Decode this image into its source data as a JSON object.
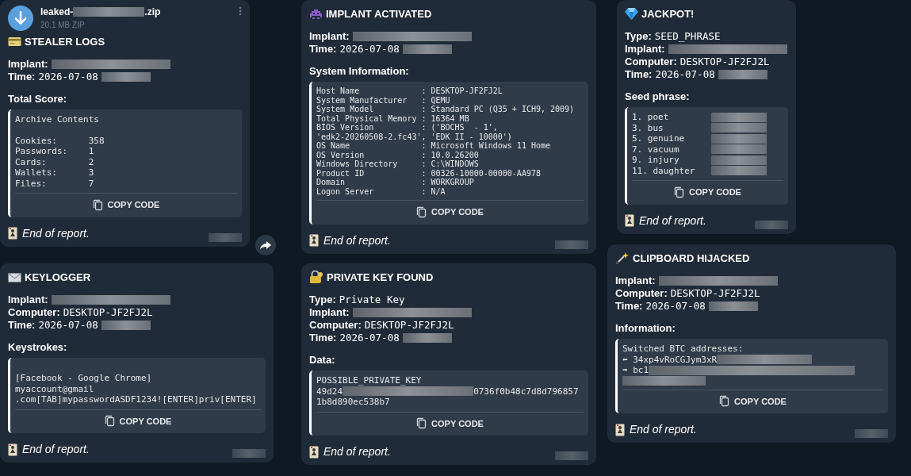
{
  "cards": [
    {
      "file": {
        "name_start": "leaked-",
        "name_redacted": true,
        "name_end": ".zip",
        "size": "20.1 MB ZIP"
      },
      "kind": "card",
      "title": "STEALER LOGS",
      "fields": [
        {
          "label": "Implant:",
          "redacted": true
        },
        {
          "label": "Time:",
          "value": "2026-07-08",
          "redacted": true
        }
      ],
      "section": "Total Score:",
      "code": [
        {
          "kind": "text",
          "text": "Archive Contents"
        },
        {
          "kind": "blank"
        },
        {
          "kind": "text",
          "text": "Cookies:      358"
        },
        {
          "kind": "text",
          "text": "Passwords:    1"
        },
        {
          "kind": "text",
          "text": "Cards:        2"
        },
        {
          "kind": "text",
          "text": "Wallets:      3"
        },
        {
          "kind": "text",
          "text": "Files:        7"
        }
      ],
      "copy": "COPY CODE",
      "footer": "End of report.",
      "forward_button": true
    },
    {
      "kind": "envelope",
      "title": "KEYLOGGER",
      "fields": [
        {
          "label": "Implant:",
          "redacted": true
        },
        {
          "label": "Computer:",
          "value": "DESKTOP-JF2FJ2L"
        },
        {
          "label": "Time:",
          "value": "2026-07-08",
          "redacted": true
        }
      ],
      "section": "Keystrokes:",
      "code": [
        {
          "kind": "blank"
        },
        {
          "kind": "text",
          "text": "[Facebook - Google Chrome]"
        },
        {
          "kind": "text",
          "text": "myaccount@gmail"
        },
        {
          "kind": "text",
          "text": ".com[TAB]mypasswordASDF1234![ENTER]priv[ENTER]"
        }
      ],
      "copy": "COPY CODE",
      "footer": "End of report."
    },
    {
      "kind": "alien",
      "title": "IMPLANT ACTIVATED",
      "fields": [
        {
          "label": "Implant:",
          "redacted": true
        },
        {
          "label": "Time:",
          "value": "2026-07-08",
          "redacted": true
        }
      ],
      "section": "System Information:",
      "code": [
        {
          "kind": "text",
          "text": "Host Name             : DESKTOP-JF2FJ2L"
        },
        {
          "kind": "text",
          "text": "System Manufacturer   : QEMU"
        },
        {
          "kind": "text",
          "text": "System Model          : Standard PC (Q35 + ICH9, 2009)"
        },
        {
          "kind": "text",
          "text": "Total Physical Memory : 16364 MB"
        },
        {
          "kind": "text",
          "text": "BIOS Version          : ('BOCHS  - 1',"
        },
        {
          "kind": "text",
          "text": "'edk2-20260508-2.fc43', 'EDK II - 10000')"
        },
        {
          "kind": "text",
          "text": "OS Name               : Microsoft Windows 11 Home"
        },
        {
          "kind": "text",
          "text": "OS Version            : 10.0.26200"
        },
        {
          "kind": "text",
          "text": "Windows Directory     : C:\\WINDOWS"
        },
        {
          "kind": "text",
          "text": "Product ID            : 00326-10000-00000-AA978"
        },
        {
          "kind": "text",
          "text": "Domain                : WORKGROUP"
        },
        {
          "kind": "text",
          "text": "Logon Server          : N/A"
        }
      ],
      "copy": "COPY CODE",
      "footer": "End of report."
    },
    {
      "kind": "lock",
      "title": "PRIVATE KEY FOUND",
      "fields": [
        {
          "label": "Type:",
          "value": "Private Key"
        },
        {
          "label": "Implant:",
          "redacted": true
        },
        {
          "label": "Computer:",
          "value": "DESKTOP-JF2FJ2L"
        },
        {
          "label": "Time:",
          "value": "2026-07-08",
          "redacted": true
        }
      ],
      "section": "Data:",
      "code": [
        {
          "kind": "text",
          "text": "POSSIBLE_PRIVATE_KEY"
        },
        {
          "kind": "text",
          "text": "49d24",
          "redacted": true,
          "after": "0736f0b48c7d8d796857"
        },
        {
          "kind": "text",
          "text": "1b8d890ec538b7"
        }
      ],
      "copy": "COPY CODE",
      "footer": "End of report."
    },
    {
      "kind": "gem",
      "title": "JACKPOT!",
      "fields": [
        {
          "label": "Type:",
          "value": "SEED_PHRASE"
        },
        {
          "label": "Implant:",
          "redacted": true
        },
        {
          "label": "Computer:",
          "value": "DESKTOP-JF2FJ2L"
        },
        {
          "label": "Time:",
          "value": "2026-07-08",
          "redacted": true
        }
      ],
      "section": "Seed phrase:",
      "code": [
        {
          "kind": "text",
          "text": "1. poet",
          "redacted": true
        },
        {
          "kind": "text",
          "text": "3. bus",
          "redacted": true
        },
        {
          "kind": "text",
          "text": "5. genuine",
          "redacted": true
        },
        {
          "kind": "text",
          "text": "7. vacuum",
          "redacted": true
        },
        {
          "kind": "text",
          "text": "9. injury",
          "redacted": true
        },
        {
          "kind": "text",
          "text": "11. daughter",
          "redacted": true
        }
      ],
      "copy": "COPY CODE",
      "footer": "End of report."
    },
    {
      "kind": "wand",
      "title": "CLIPBOARD HIJACKED",
      "fields": [
        {
          "label": "Implant:",
          "redacted": true
        },
        {
          "label": "Computer:",
          "value": "DESKTOP-JF2FJ2L"
        },
        {
          "label": "Time:",
          "value": "2026-07-08",
          "redacted": true
        }
      ],
      "section": "Information:",
      "code": [
        {
          "kind": "text",
          "text": "Switched BTC addresses:"
        },
        {
          "kind": "text",
          "text": "⬅ 34xp4vRoCGJym3xR",
          "redacted": true
        },
        {
          "kind": "text",
          "text": "➡ bc1",
          "redacted": true
        },
        {
          "kind": "text",
          "redacted": true
        }
      ],
      "copy": "COPY CODE",
      "footer": "End of report."
    }
  ]
}
